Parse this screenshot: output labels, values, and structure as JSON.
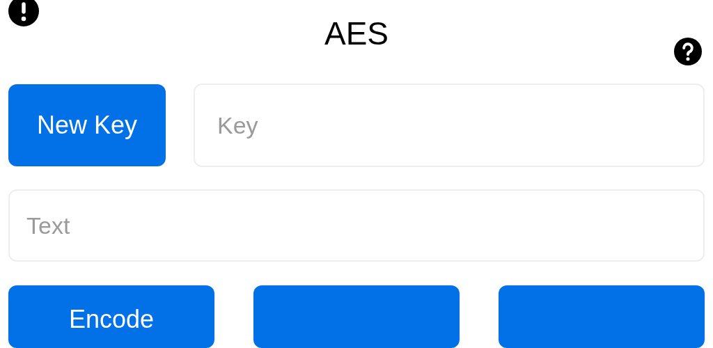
{
  "title": "AES",
  "new_key_button": {
    "label": "New Key"
  },
  "key_field": {
    "placeholder": "Key"
  },
  "text_field": {
    "placeholder": "Text"
  },
  "action_buttons": [
    {
      "kind": "labeled",
      "label": "Encode"
    },
    {
      "kind": "blank"
    },
    {
      "kind": "blank"
    }
  ]
}
